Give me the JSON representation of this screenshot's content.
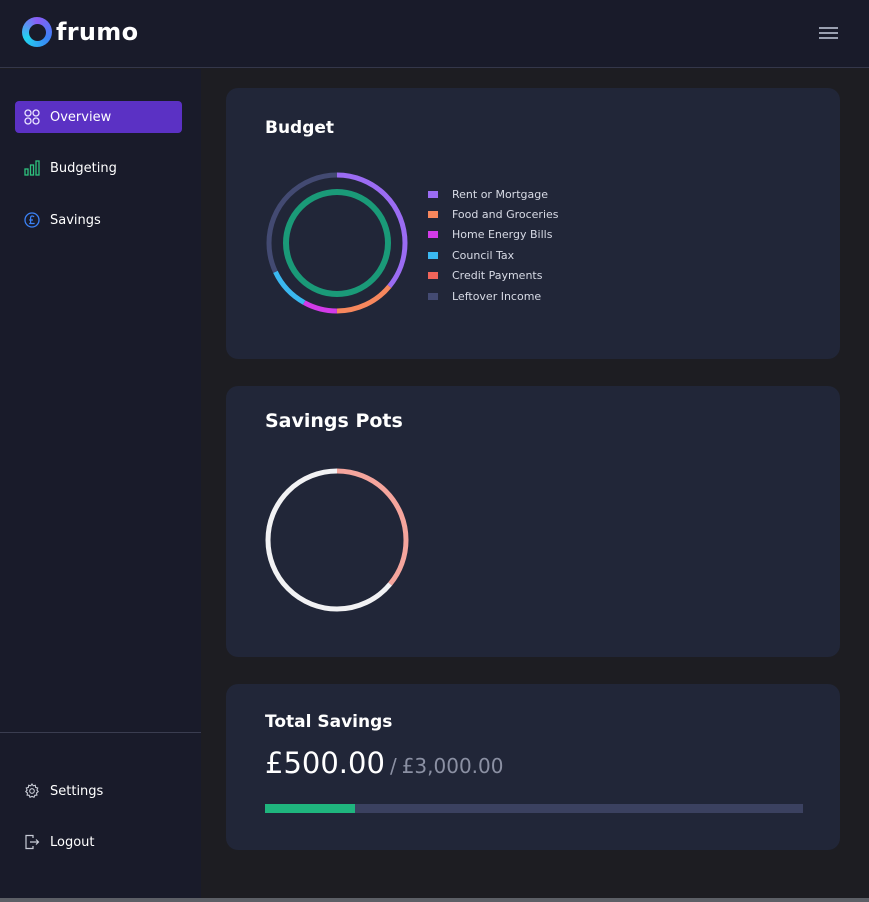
{
  "app": {
    "name": "frumo"
  },
  "sidebar": {
    "items": [
      {
        "label": "Overview",
        "icon": "grid-icon",
        "active": true
      },
      {
        "label": "Budgeting",
        "icon": "bar-chart-icon",
        "active": false
      },
      {
        "label": "Savings",
        "icon": "pound-coin-icon",
        "active": false
      }
    ],
    "footer_items": [
      {
        "label": "Settings",
        "icon": "gear-icon"
      },
      {
        "label": "Logout",
        "icon": "logout-icon"
      }
    ]
  },
  "budget": {
    "title": "Budget",
    "legend": [
      {
        "label": "Rent or Mortgage",
        "color": "#9b6cf3"
      },
      {
        "label": "Food and Groceries",
        "color": "#f7875d"
      },
      {
        "label": "Home Energy Bills",
        "color": "#d23be9"
      },
      {
        "label": "Council Tax",
        "color": "#3ab8f0"
      },
      {
        "label": "Credit Payments",
        "color": "#f0645a"
      },
      {
        "label": "Leftover Income",
        "color": "#434a72"
      }
    ]
  },
  "savings_pots": {
    "title": "Savings Pots"
  },
  "total_savings": {
    "title": "Total Savings",
    "amount": "£500.00",
    "separator": "/",
    "goal": "£3,000.00",
    "progress_fraction": 0.1667,
    "progress_color": "#1fb57e"
  },
  "chart_data": [
    {
      "type": "pie",
      "title": "Budget",
      "categories": [
        "Rent or Mortgage",
        "Food and Groceries",
        "Home Energy Bills",
        "Council Tax",
        "Credit Payments",
        "Leftover Income"
      ],
      "values": [
        0.36,
        0.14,
        0.08,
        0.1,
        0.0,
        0.32
      ],
      "colors": [
        "#9b6cf3",
        "#f7875d",
        "#d23be9",
        "#3ab8f0",
        "#f0645a",
        "#434a72"
      ],
      "inner_ring": {
        "color": "#1a9a78",
        "value": 1.0
      },
      "legend_position": "right"
    },
    {
      "type": "pie",
      "title": "Savings Pots",
      "values": [
        0.36,
        0.64
      ],
      "colors": [
        "#f5a59d",
        "#f2f2f4"
      ]
    }
  ]
}
